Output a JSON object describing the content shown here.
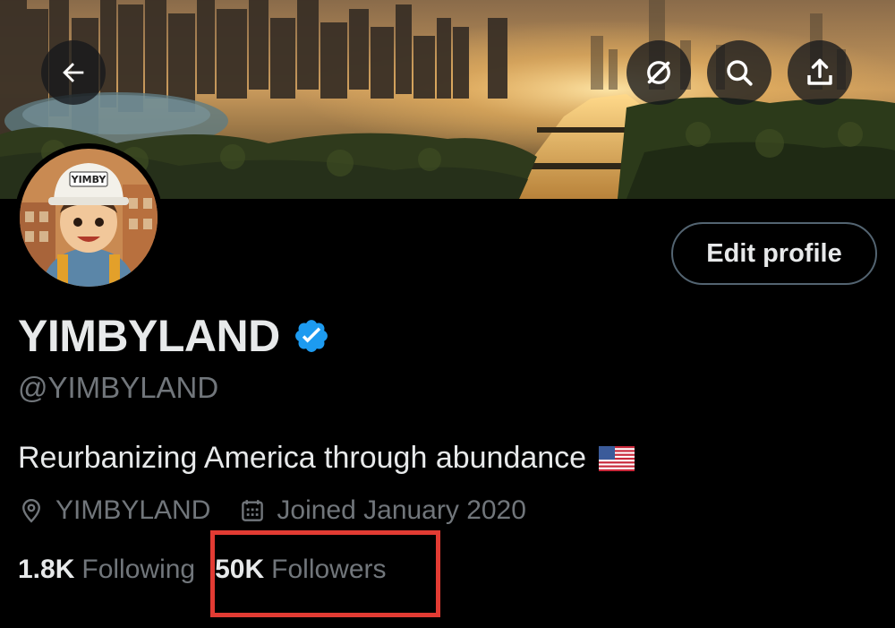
{
  "header": {
    "icons": [
      "back-arrow-icon",
      "grok-icon",
      "search-icon",
      "share-icon"
    ]
  },
  "profile": {
    "avatar_badge": "YIMBY",
    "display_name": "YIMBYLAND",
    "verified": true,
    "handle": "@YIMBYLAND",
    "bio": "Reurbanizing America through abundance",
    "location": "YIMBYLAND",
    "joined": "Joined January 2020",
    "edit_button": "Edit profile"
  },
  "stats": {
    "following_count": "1.8K",
    "following_label": "Following",
    "followers_count": "50K",
    "followers_label": "Followers"
  },
  "colors": {
    "background": "#000000",
    "text_primary": "#e7e9ea",
    "text_secondary": "#71767b",
    "verified_blue": "#1d9bf0",
    "highlight_red": "#e23b33"
  }
}
